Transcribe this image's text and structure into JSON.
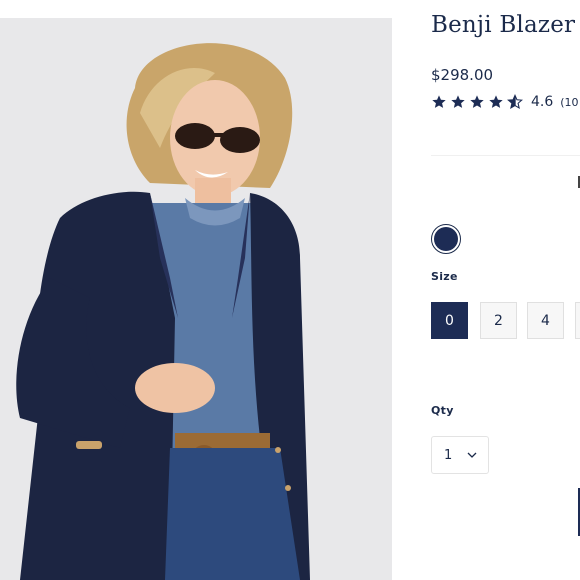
{
  "product": {
    "title": "Benji Blazer",
    "price": "$298.00",
    "rating_value": "4.6",
    "rating_count": "(10",
    "stars": {
      "full": 4,
      "half": 1
    }
  },
  "color": {
    "selected_hex": "#1d2c55"
  },
  "size": {
    "label": "Size",
    "options": [
      "0",
      "2",
      "4"
    ],
    "selected": "0"
  },
  "quantity": {
    "label": "Qty",
    "value": "1"
  },
  "icons": {
    "star": "star-icon",
    "chevron": "chevron-down-icon"
  },
  "colors": {
    "navy": "#1d2c55",
    "text": "#1b2a4a"
  }
}
